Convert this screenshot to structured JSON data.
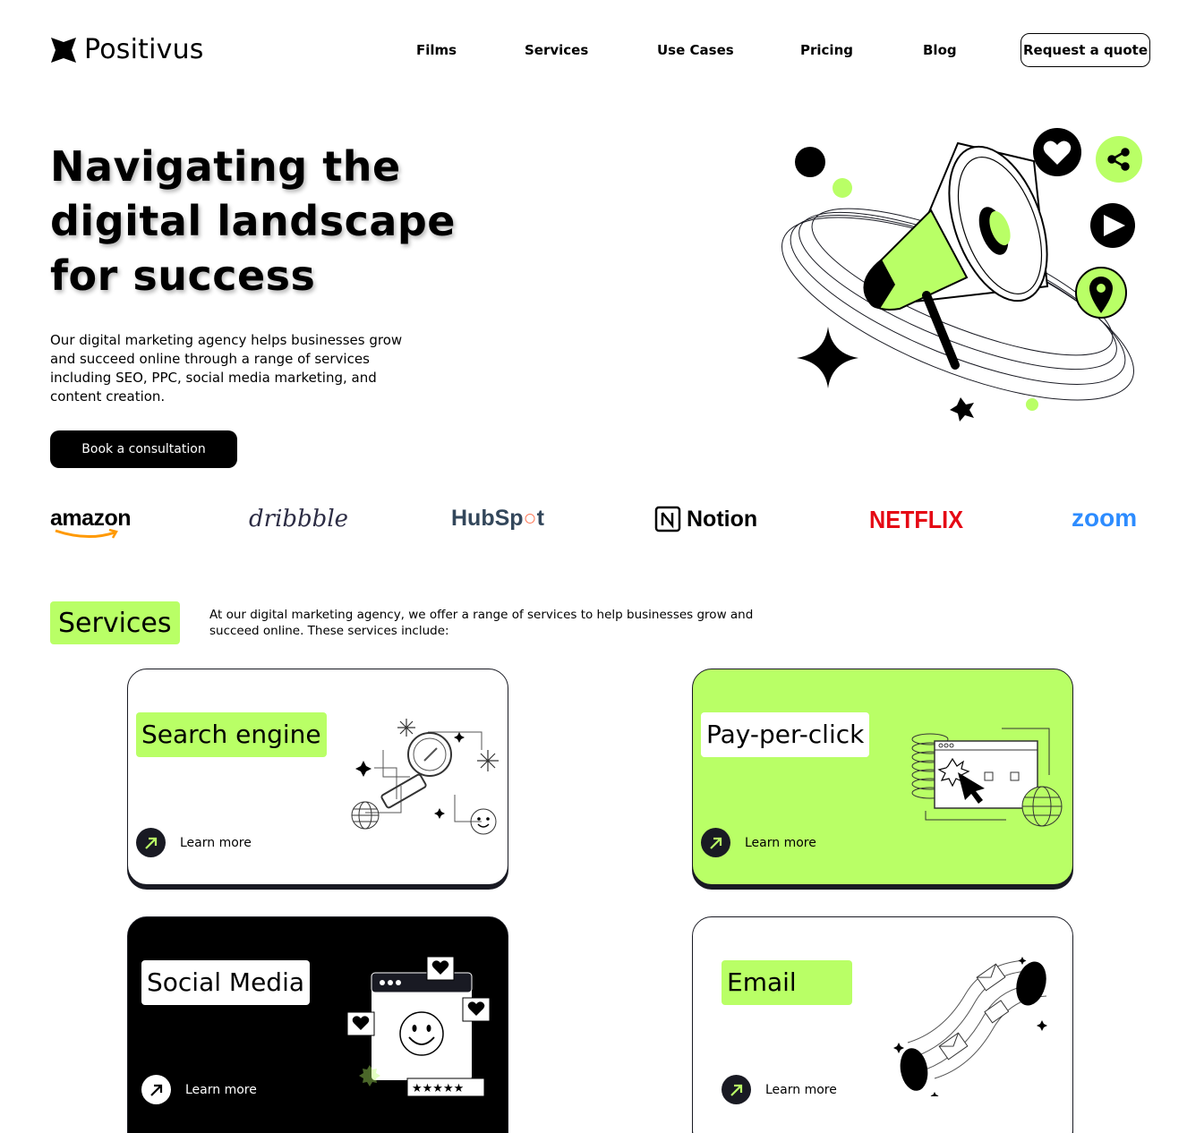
{
  "header": {
    "brand": "Positivus",
    "nav": [
      "Films",
      "Services",
      "Use Cases",
      "Pricing",
      "Blog"
    ],
    "cta": "Request a quote"
  },
  "hero": {
    "title_lines": [
      "Navigating the",
      "digital landscape",
      "for success"
    ],
    "description": "Our digital marketing agency helps businesses grow and succeed online through a range of services including SEO, PPC, social media marketing, and content creation.",
    "button": "Book a consultation"
  },
  "brands": {
    "amazon": "amazon",
    "dribbble": "dribbble",
    "hubspot_a": "HubSp",
    "hubspot_b": "t",
    "notion": "Notion",
    "netflix": "NETFLIX",
    "zoom": "zoom"
  },
  "services": {
    "heading": "Services",
    "intro": "At our digital marketing agency, we offer a range of services to help businesses grow and succeed online. These services include:",
    "cards": [
      {
        "title": "Search engine",
        "link": "Learn more",
        "theme": "light"
      },
      {
        "title": "Pay-per-click",
        "link": "Learn more",
        "theme": "green"
      },
      {
        "title": "Social Media",
        "link": "Learn more",
        "theme": "dark"
      },
      {
        "title": "Email",
        "link": "Learn more",
        "theme": "light"
      }
    ]
  },
  "colors": {
    "accent": "#b9ff66",
    "dark": "#191a23",
    "background": "#ffffff"
  },
  "icons": [
    "logo-star-icon",
    "megaphone-illustration",
    "heart-icon",
    "share-icon",
    "play-icon",
    "location-pin-icon",
    "arrow-up-right-icon"
  ]
}
